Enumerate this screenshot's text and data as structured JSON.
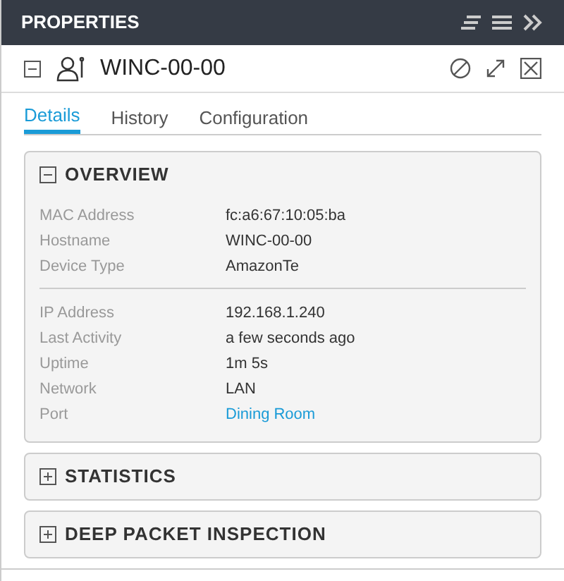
{
  "panel": {
    "title": "PROPERTIES"
  },
  "device": {
    "name": "WINC-00-00",
    "expanded": true
  },
  "tabs": [
    {
      "label": "Details",
      "selected": true
    },
    {
      "label": "History",
      "selected": false
    },
    {
      "label": "Configuration",
      "selected": false
    }
  ],
  "sections": [
    {
      "title": "OVERVIEW",
      "expanded": true,
      "groups": [
        [
          {
            "label": "MAC Address",
            "value": "fc:a6:67:10:05:ba",
            "kind": "text"
          },
          {
            "label": "Hostname",
            "value": "WINC-00-00",
            "kind": "text"
          },
          {
            "label": "Device Type",
            "value": "AmazonTe",
            "kind": "text"
          }
        ],
        [
          {
            "label": "IP Address",
            "value": "192.168.1.240",
            "kind": "text"
          },
          {
            "label": "Last Activity",
            "value": "a few seconds ago",
            "kind": "text"
          },
          {
            "label": "Uptime",
            "value": "1m 5s",
            "kind": "text"
          },
          {
            "label": "Network",
            "value": "LAN",
            "kind": "text"
          },
          {
            "label": "Port",
            "value": "Dining Room",
            "kind": "link"
          }
        ]
      ]
    },
    {
      "title": "STATISTICS",
      "expanded": false
    },
    {
      "title": "DEEP PACKET INSPECTION",
      "expanded": false
    }
  ]
}
